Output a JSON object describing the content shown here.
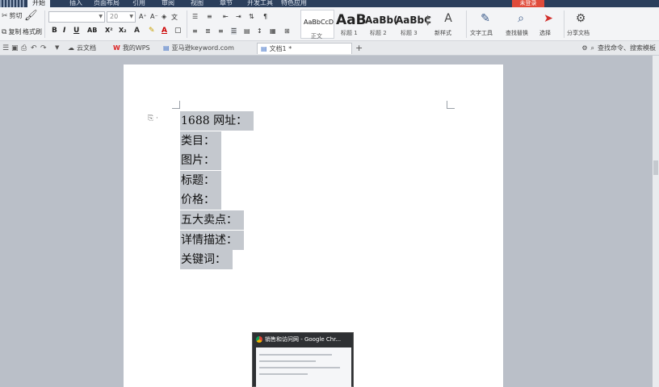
{
  "menubar": {
    "items": [
      "开始",
      "插入",
      "页面布局",
      "引用",
      "审阅",
      "视图",
      "章节",
      "开发工具",
      "特色应用"
    ],
    "login": "未登录"
  },
  "ribbon": {
    "cut": "剪切",
    "copy": "复制",
    "format_painter": "格式刷",
    "font_name": "",
    "font_size": "20",
    "styles": [
      {
        "sample": "AaBbCcD",
        "label": "正文"
      },
      {
        "sample": "AaB",
        "label": "标题 1"
      },
      {
        "sample": "AaBb(",
        "label": "标题 2"
      },
      {
        "sample": "AaBbC",
        "label": "标题 3"
      }
    ],
    "new_style": "新样式",
    "text_tools": "文字工具",
    "find_replace": "查找替换",
    "select": "选择",
    "share_doc": "分享文档"
  },
  "tabbar": {
    "tabs": [
      {
        "label": "云文档",
        "kind": "cloud"
      },
      {
        "label": "我的WPS",
        "kind": "wps"
      },
      {
        "label": "亚马逊keyword.com",
        "kind": "file"
      },
      {
        "label": "文档1 *",
        "kind": "doc",
        "active": true
      }
    ],
    "search_placeholder": "查找命令、搜索模板"
  },
  "document": {
    "lines": [
      "1688 网址：",
      "类目：",
      "图片：",
      "标题：",
      "价格：",
      "五大卖点：",
      "详情描述：",
      "关键词："
    ]
  },
  "popup": {
    "title": "销售和访问网 - Google Chr..."
  }
}
